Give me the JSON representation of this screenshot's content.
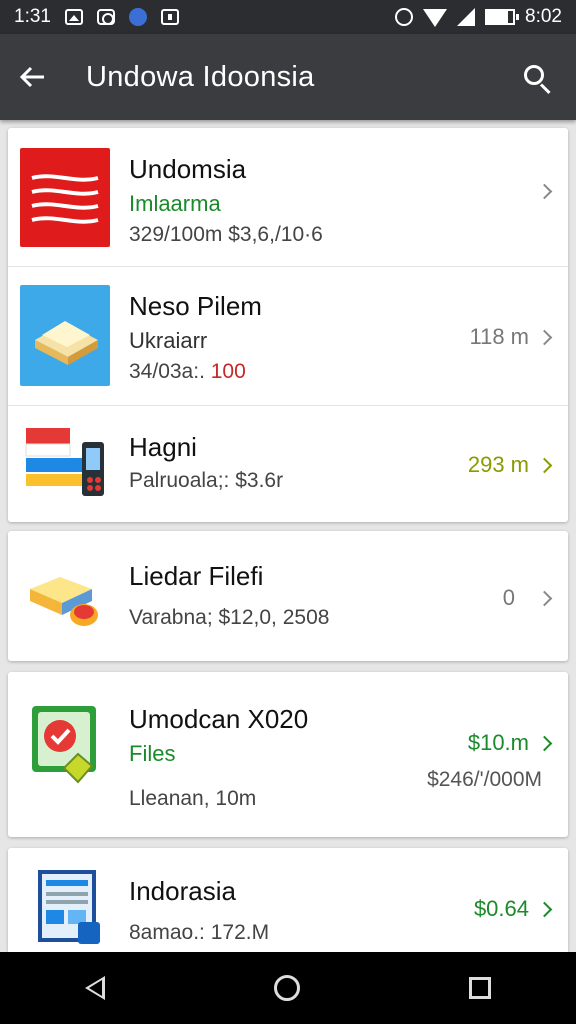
{
  "status_bar": {
    "time_left": "1:31",
    "time_right": "8:02",
    "icons": [
      "image-icon",
      "camera-icon",
      "app-icon",
      "bag-icon",
      "alarm-icon",
      "wifi-icon",
      "signal-icon",
      "battery-icon"
    ]
  },
  "app_bar": {
    "back_icon": "arrow-back-icon",
    "title": "Undowa Idoonsia",
    "search_icon": "search-icon"
  },
  "colors": {
    "app_bar": "#3a3c40",
    "status_bar": "#2b2d31",
    "green": "#1b8a2a",
    "olive": "#8a9a00",
    "red": "#c62828"
  },
  "cards": [
    {
      "rows": [
        {
          "title": "Undomsia",
          "subtitle": "Imlaarma",
          "meta": "329/100m   $3,6,/10·6",
          "right": "",
          "thumb": "red-stripes-icon"
        },
        {
          "title": "Neso Pilem",
          "subtitle": "Ukraiarr",
          "meta_prefix": "34/03a:.",
          "meta_red": "100",
          "right": "118 m",
          "thumb": "folder-3d-icon"
        },
        {
          "title": "Hagni",
          "meta": "Palruoala;: $3.6r",
          "right": "293 m",
          "thumb": "flag-phone-icon"
        }
      ]
    },
    {
      "rows": [
        {
          "title": "Liedar Filefi",
          "meta": "Varabna;   $12,0, 2508",
          "right": "0",
          "thumb": "folder-badge-icon"
        }
      ]
    },
    {
      "rows": [
        {
          "title": "Umodcan X020",
          "subtitle": "Files",
          "meta": "Lleanan, 10m",
          "right": "$10.m",
          "right2": "$246/'/000M",
          "thumb": "green-app-icon"
        }
      ]
    },
    {
      "rows": [
        {
          "title": "Indorasia",
          "meta": "8amao.: 172.M",
          "right": "$0.64",
          "thumb": "document-icon"
        }
      ]
    }
  ],
  "nav": {
    "back": "nav-back-icon",
    "home": "nav-home-icon",
    "recent": "nav-recent-icon"
  }
}
